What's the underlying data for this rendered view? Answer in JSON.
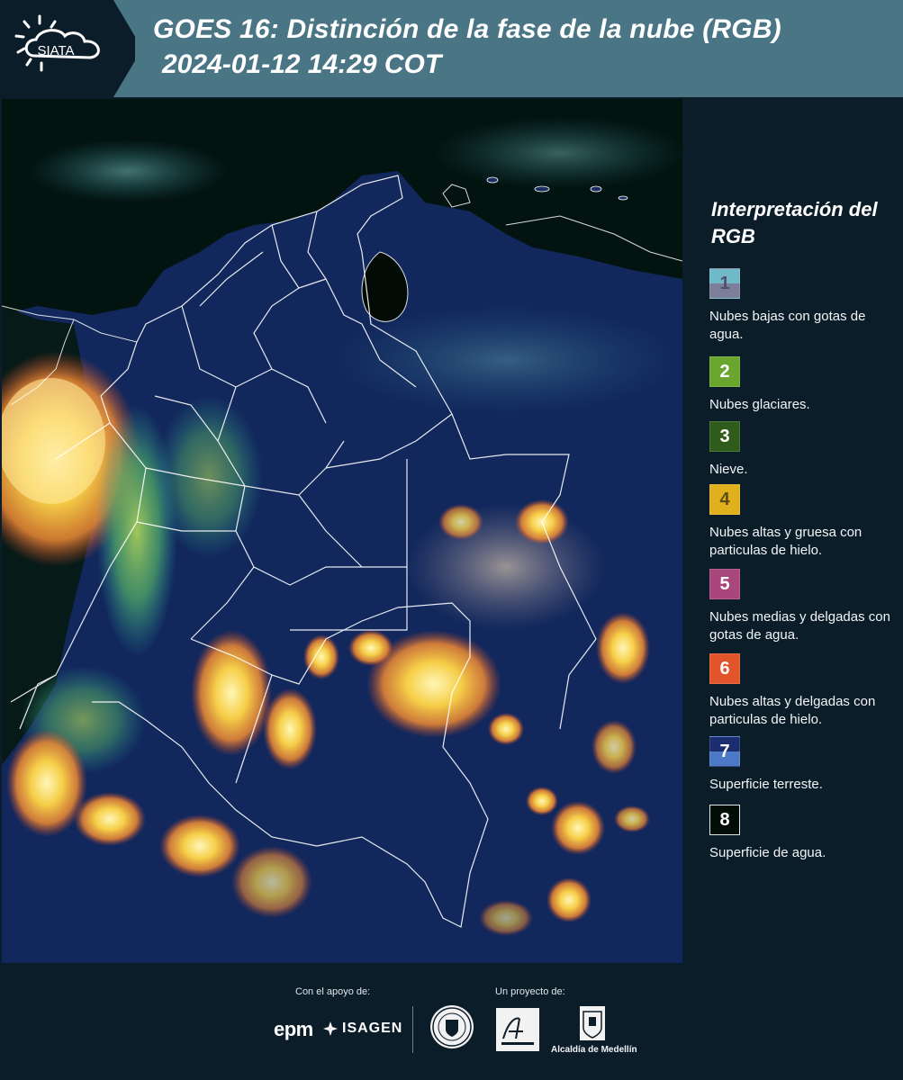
{
  "header": {
    "logo_text": "SIATA",
    "title": "GOES 16: Distinción de la fase de la nube (RGB)",
    "timestamp": "2024-01-12 14:29 COT",
    "colors": {
      "bar": "#4a7585",
      "logo_bg": "#0c1d2a"
    }
  },
  "legend": {
    "title": "Interpretación del RGB",
    "items": [
      {
        "number": "1",
        "label": "Nubes bajas con gotas de agua.",
        "colors": [
          "#6fb9c8",
          "#7d7f9a"
        ]
      },
      {
        "number": "2",
        "label": "Nubes glaciares.",
        "colors": [
          "#6aa62e"
        ]
      },
      {
        "number": "3",
        "label": "Nieve.",
        "colors": [
          "#2f5c1a"
        ]
      },
      {
        "number": "4",
        "label": "Nubes altas y gruesa con particulas de hielo.",
        "colors": [
          "#e0b11c"
        ]
      },
      {
        "number": "5",
        "label": "Nubes medias y delgadas con gotas de agua.",
        "colors": [
          "#a9477d"
        ]
      },
      {
        "number": "6",
        "label": "Nubes altas y delgadas con particulas de hielo.",
        "colors": [
          "#e2542a"
        ]
      },
      {
        "number": "7",
        "label": "Superficie terreste.",
        "colors": [
          "#1b2d6e",
          "#4c79c6"
        ]
      },
      {
        "number": "8",
        "label": "Superficie de agua.",
        "colors": [
          "#030d07"
        ]
      }
    ]
  },
  "footer": {
    "support_label": "Con el apoyo de:",
    "project_label": "Un proyecto de:",
    "sponsors": [
      "epm",
      "ISAGEN"
    ],
    "partners": [
      "Alcaldía de Medellín"
    ],
    "logos": [
      "epm-logo",
      "isagen-logo",
      "medellin-seal-logo",
      "area-metropolitana-logo",
      "alcaldia-medellin-logo"
    ]
  },
  "map": {
    "description_colors": {
      "land": "#13285e",
      "water": "#02100c",
      "boundary": "#ffffff",
      "ice_cloud": "#f4c54a",
      "glaciar": "#74c13b",
      "low_cloud": "#5fc0c4"
    }
  }
}
